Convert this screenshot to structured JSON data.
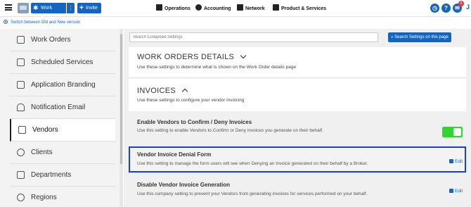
{
  "header": {
    "work_order_label": "Work Order",
    "more_label": "⋮",
    "invite_label": "Invite",
    "nav": [
      {
        "label": "Operations"
      },
      {
        "label": "Accounting"
      },
      {
        "label": "Network"
      },
      {
        "label": "Product & Services"
      }
    ],
    "help_label": "?",
    "notification_count": "6",
    "user_initial": "J"
  },
  "version_switch_label": "Switch between Old and New version",
  "sidebar": {
    "items": [
      {
        "label": "Work Orders",
        "icon": "clipboard-icon"
      },
      {
        "label": "Scheduled Services",
        "icon": "calendar-icon"
      },
      {
        "label": "Application Branding",
        "icon": "palette-icon"
      },
      {
        "label": "Notification Email",
        "icon": "bell-icon"
      },
      {
        "label": "Vendors",
        "icon": "building-icon",
        "active": true
      },
      {
        "label": "Clients",
        "icon": "person-icon"
      },
      {
        "label": "Departments",
        "icon": "departments-icon"
      },
      {
        "label": "Regions",
        "icon": "globe-icon"
      }
    ]
  },
  "search": {
    "placeholder": "Search Collapsed Settings",
    "button_label": "Search Settings on this page"
  },
  "sections": {
    "work_orders": {
      "title": "WORK ORDERS DETAILS",
      "description": "Use these settings to determine what is shown on the Work Order details page"
    },
    "invoices": {
      "title": "INVOICES",
      "description": "Use these settings to configure your vendor invoicing"
    }
  },
  "settings": [
    {
      "title": "Enable Vendors to Confirm / Deny Invoices",
      "description": "Use this setting to enable Vendors to Confirm or Deny invoices you generate on their behalf.",
      "toggle_on": true
    },
    {
      "title": "Vendor Invoice Denial Form",
      "description": "Use this setting to manage the form users will see when Denying an Invoice generated on their behalf by a Broker.",
      "action_label": "Edit"
    },
    {
      "title": "Disable Vendor Invoice Generation",
      "description": "Use this company setting to prevent your Vendors from generating invoices for services performed on your behalf.",
      "action_label": "Edit"
    }
  ],
  "colors": {
    "primary": "#1565c0",
    "toggle_on": "#31d431",
    "highlight_border": "#1a3fcc",
    "badge": "#e53935"
  }
}
